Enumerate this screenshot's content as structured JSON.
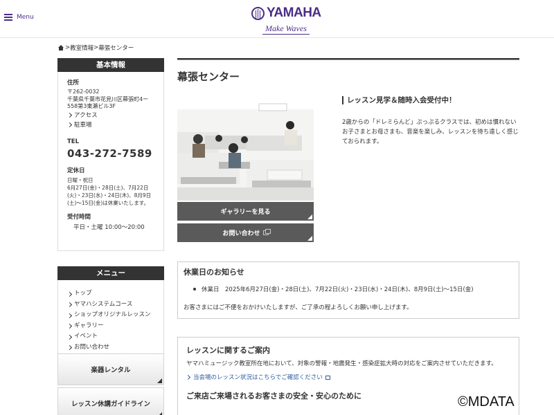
{
  "header": {
    "menu_label": "Menu",
    "logo_text": "YAMAHA",
    "logo_tagline": "Make Waves"
  },
  "breadcrumb": {
    "items": [
      "教室情報",
      "幕張センター"
    ],
    "separator": ">"
  },
  "sidebar": {
    "info_title": "基本情報",
    "address_label": "住所",
    "address_lines": [
      "〒262-0032",
      "千葉県千葉市花見川区幕張町4ー",
      "558第3東瀬ビル3F"
    ],
    "links": [
      "アクセス",
      "駐車場"
    ],
    "tel_label": "TEL",
    "tel": "043-272-7589",
    "closed_label": "定休日",
    "closed_days": "日曜・祝日",
    "closed_notes": [
      "6月27日(金)・28日(土)、7月22日",
      "(火)・23日(水)・24日(木)、8月9日",
      "(土)〜15日(金)は休業いたします。"
    ],
    "hours_label": "受付時間",
    "hours": "平日・土曜 10:00〜20:00",
    "menu_title": "メニュー",
    "menu_items": [
      "トップ",
      "ヤマハシステムコース",
      "ショップオリジナルレッスン",
      "ギャラリー",
      "イベント",
      "お問い合わせ"
    ],
    "btn_rental": "楽器レンタル",
    "btn_guideline": "レッスン休講ガイドライン"
  },
  "main": {
    "title": "幕張センター",
    "gallery_button": "ギャラリーを見る",
    "contact_button": "お問い合わせ",
    "lesson_heading": "レッスン見学＆随時入会受付中！",
    "lesson_text": "2歳からの「ドレミらんど」ぷっぷるクラスでは、初めは慣れないお子さまとお母さまも、音楽を楽しみ、レッスンを待ち遠しく感じておられます。",
    "notice_heading": "休業日のお知らせ",
    "notice_item": "休業日　2025年6月27日(金)・28日(土)、7月22日(火)・23日(水)・24日(木)、8月9日(土)〜15日(金)",
    "notice_text": "お客さまにはご不便をおかけいたしますが、ご了承の程よろしくお願い申し上げます。",
    "guide_heading": "レッスンに関するご案内",
    "guide_text": "ヤマハミュージック教室所在地において、対象の警報・地震発生・感染症拡大時の対応をご案内させていただきます。",
    "guide_link": "当会場のレッスン状況はこちらでご確認ください",
    "guide_heading2": "ご来店ご来場されるお客さまの安全・安心のために"
  },
  "watermark": "©MDATA",
  "colors": {
    "brand_purple": "#4b2c86",
    "dark_bar": "#333333",
    "button_gray": "#5a5a5a",
    "link_blue": "#2c5aa0"
  }
}
